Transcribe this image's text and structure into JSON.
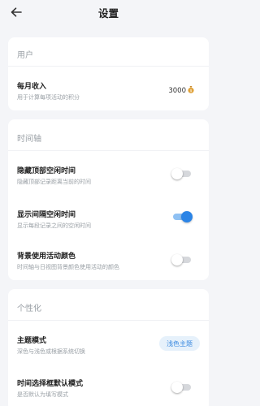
{
  "header": {
    "title": "设置"
  },
  "user_section": {
    "title": "用户",
    "monthly_income": {
      "label": "每月收入",
      "desc": "用于计算每项活动的积分",
      "value": "3000"
    }
  },
  "timeline_section": {
    "title": "时间轴",
    "hide_top_gap": {
      "label": "隐藏顶部空闲时间",
      "desc": "隐藏顶部记录距离当前的时间",
      "enabled": false
    },
    "show_gap": {
      "label": "显示间隔空闲时间",
      "desc": "显示每段记录之间的空闲时间",
      "enabled": true
    },
    "activity_bg": {
      "label": "背景使用活动颜色",
      "desc": "时间轴与日视图背景颜色使用活动的颜色",
      "enabled": false
    }
  },
  "personal_section": {
    "title": "个性化",
    "theme_mode": {
      "label": "主题模式",
      "desc": "深色与浅色或根据系统切换",
      "value": "浅色主题"
    },
    "time_picker_mode": {
      "label": "时间选择框默认模式",
      "desc": "是否默认为填写模式",
      "enabled": false
    }
  },
  "colors": {
    "accent": "#2b84e6",
    "background": "#f4f5f8"
  }
}
